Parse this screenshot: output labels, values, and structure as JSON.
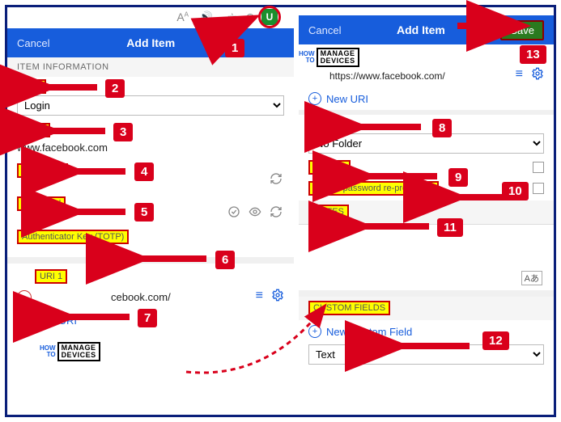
{
  "left": {
    "cancel": "Cancel",
    "title": "Add Item",
    "section": "ITEM INFORMATION",
    "type_label": "Type",
    "type_value": "Login",
    "name_label": "Name",
    "name_value": "www.facebook.com",
    "username_label": "Username",
    "password_label": "Password",
    "totp_label": "Authenticator Key (TOTP)",
    "uri1_label": "URI 1",
    "uri1_value": "cebook.com/",
    "new_uri": "New URI"
  },
  "right": {
    "cancel": "Cancel",
    "title": "Add Item",
    "save": "Save",
    "uri_value": "https://www.facebook.com/",
    "new_uri": "New URI",
    "folder_label": "Folder",
    "folder_value": "No Folder",
    "favorite_label": "Favorite",
    "reprompt_label": "Master password re-prompt",
    "notes_label": "NOTES",
    "custom_label": "CUSTOM FIELDS",
    "new_custom": "New Custom Field",
    "custom_type": "Text"
  },
  "logo": {
    "howto": "HOW\nTO",
    "brand": "MANAGE\nDEVICES"
  },
  "ann": {
    "n1": "1",
    "n2": "2",
    "n3": "3",
    "n4": "4",
    "n5": "5",
    "n6": "6",
    "n7": "7",
    "n8": "8",
    "n9": "9",
    "n10": "10",
    "n11": "11",
    "n12": "12",
    "n13": "13"
  }
}
